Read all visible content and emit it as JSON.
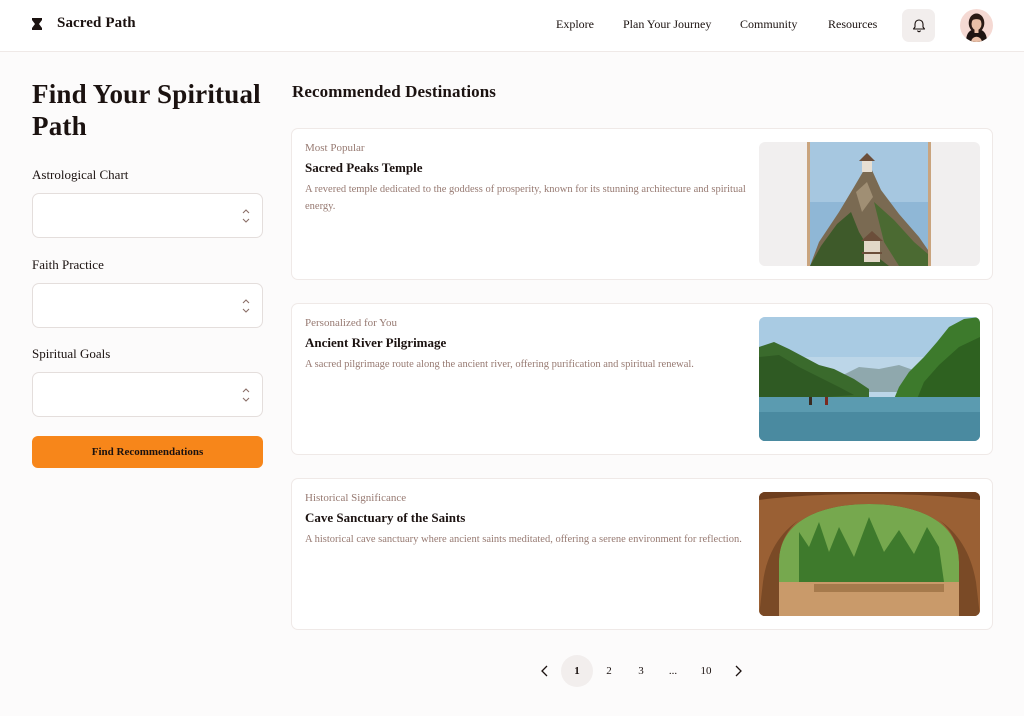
{
  "header": {
    "brand": "Sacred Path",
    "nav": [
      "Explore",
      "Plan Your Journey",
      "Community",
      "Resources"
    ],
    "icons": {
      "logo": "hourglass-icon",
      "notifications": "bell-icon",
      "avatar": "user-avatar"
    }
  },
  "sidebar": {
    "title": "Find Your Spiritual Path",
    "fields": [
      {
        "label": "Astrological Chart",
        "value": ""
      },
      {
        "label": "Faith Practice",
        "value": ""
      },
      {
        "label": "Spiritual Goals",
        "value": ""
      }
    ],
    "button_label": "Find Recommendations"
  },
  "main": {
    "section_title": "Recommended Destinations",
    "cards": [
      {
        "tag": "Most Popular",
        "title": "Sacred Peaks Temple",
        "description": "A revered temple dedicated to the goddess of prosperity, known for its stunning architecture and spiritual energy."
      },
      {
        "tag": "Personalized for You",
        "title": "Ancient River Pilgrimage",
        "description": "A sacred pilgrimage route along the ancient river, offering purification and spiritual renewal."
      },
      {
        "tag": "Historical Significance",
        "title": "Cave Sanctuary of the Saints",
        "description": "A historical cave sanctuary where ancient saints meditated, offering a serene environment for reflection."
      }
    ]
  },
  "pagination": {
    "pages": [
      "1",
      "2",
      "3",
      "...",
      "10"
    ],
    "current": "1"
  },
  "colors": {
    "accent": "#f7861a",
    "muted_text": "#977a72",
    "text": "#1b1210",
    "chip_bg": "#f2eeed"
  }
}
